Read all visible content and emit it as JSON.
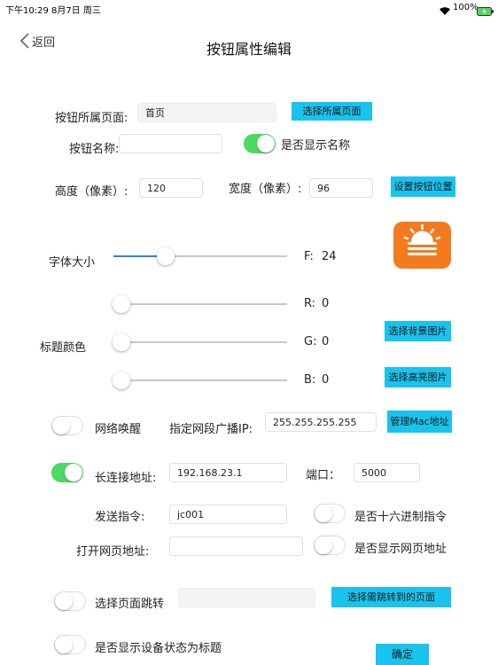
{
  "status_bar": {
    "time": "下午10:29",
    "date": "8月7日 周三",
    "battery": "100%"
  },
  "nav": {
    "back": "返回",
    "title": "按钮属性编辑"
  },
  "page_row": {
    "label": "按钮所属页面:",
    "value": "首页",
    "button": "选择所属页面"
  },
  "name_row": {
    "label": "按钮名称:",
    "value": "",
    "toggle_label": "是否显示名称",
    "toggle_on": true
  },
  "size_row": {
    "height_label": "高度（像素）:",
    "height_value": "120",
    "width_label": "宽度（像素）:",
    "width_value": "96",
    "button": "设置按钮位置"
  },
  "font_row": {
    "label": "字体大小",
    "f_label": "F:",
    "f_value": "24",
    "slider_fraction": 0.3
  },
  "color": {
    "label": "标题颜色",
    "r_label": "R:",
    "r_value": "0",
    "g_label": "G:",
    "g_value": "0",
    "b_label": "B:",
    "b_value": "0",
    "bg_button": "选择背景图片",
    "hl_button": "选择高亮图片",
    "preview_color": "#f47a1f"
  },
  "wake_row": {
    "toggle_label": "网络唤醒",
    "toggle_on": false,
    "ip_label": "指定网段广播IP:",
    "ip_value": "255.255.255.255",
    "button": "管理Mac地址"
  },
  "conn_row": {
    "toggle_on": true,
    "label": "长连接地址:",
    "address": "192.168.23.1",
    "port_label": "端口：",
    "port_value": "5000"
  },
  "cmd_row": {
    "label": "发送指令:",
    "value": "jc001",
    "toggle_label": "是否十六进制指令",
    "toggle_on": false
  },
  "url_row": {
    "label": "打开网页地址:",
    "value": "",
    "toggle_label": "是否显示网页地址",
    "toggle_on": false
  },
  "jump_row": {
    "toggle_label": "选择页面跳转",
    "toggle_on": false,
    "value": "",
    "button": "选择需跳转到的页面"
  },
  "status_title_row": {
    "toggle_label": "是否显示设备状态为标题",
    "toggle_on": false
  },
  "confirm": "确定",
  "colors": {
    "accent_button": "#18c3ee",
    "toggle_on": "#4cd964",
    "slider_fill": "#2f7ff0"
  }
}
